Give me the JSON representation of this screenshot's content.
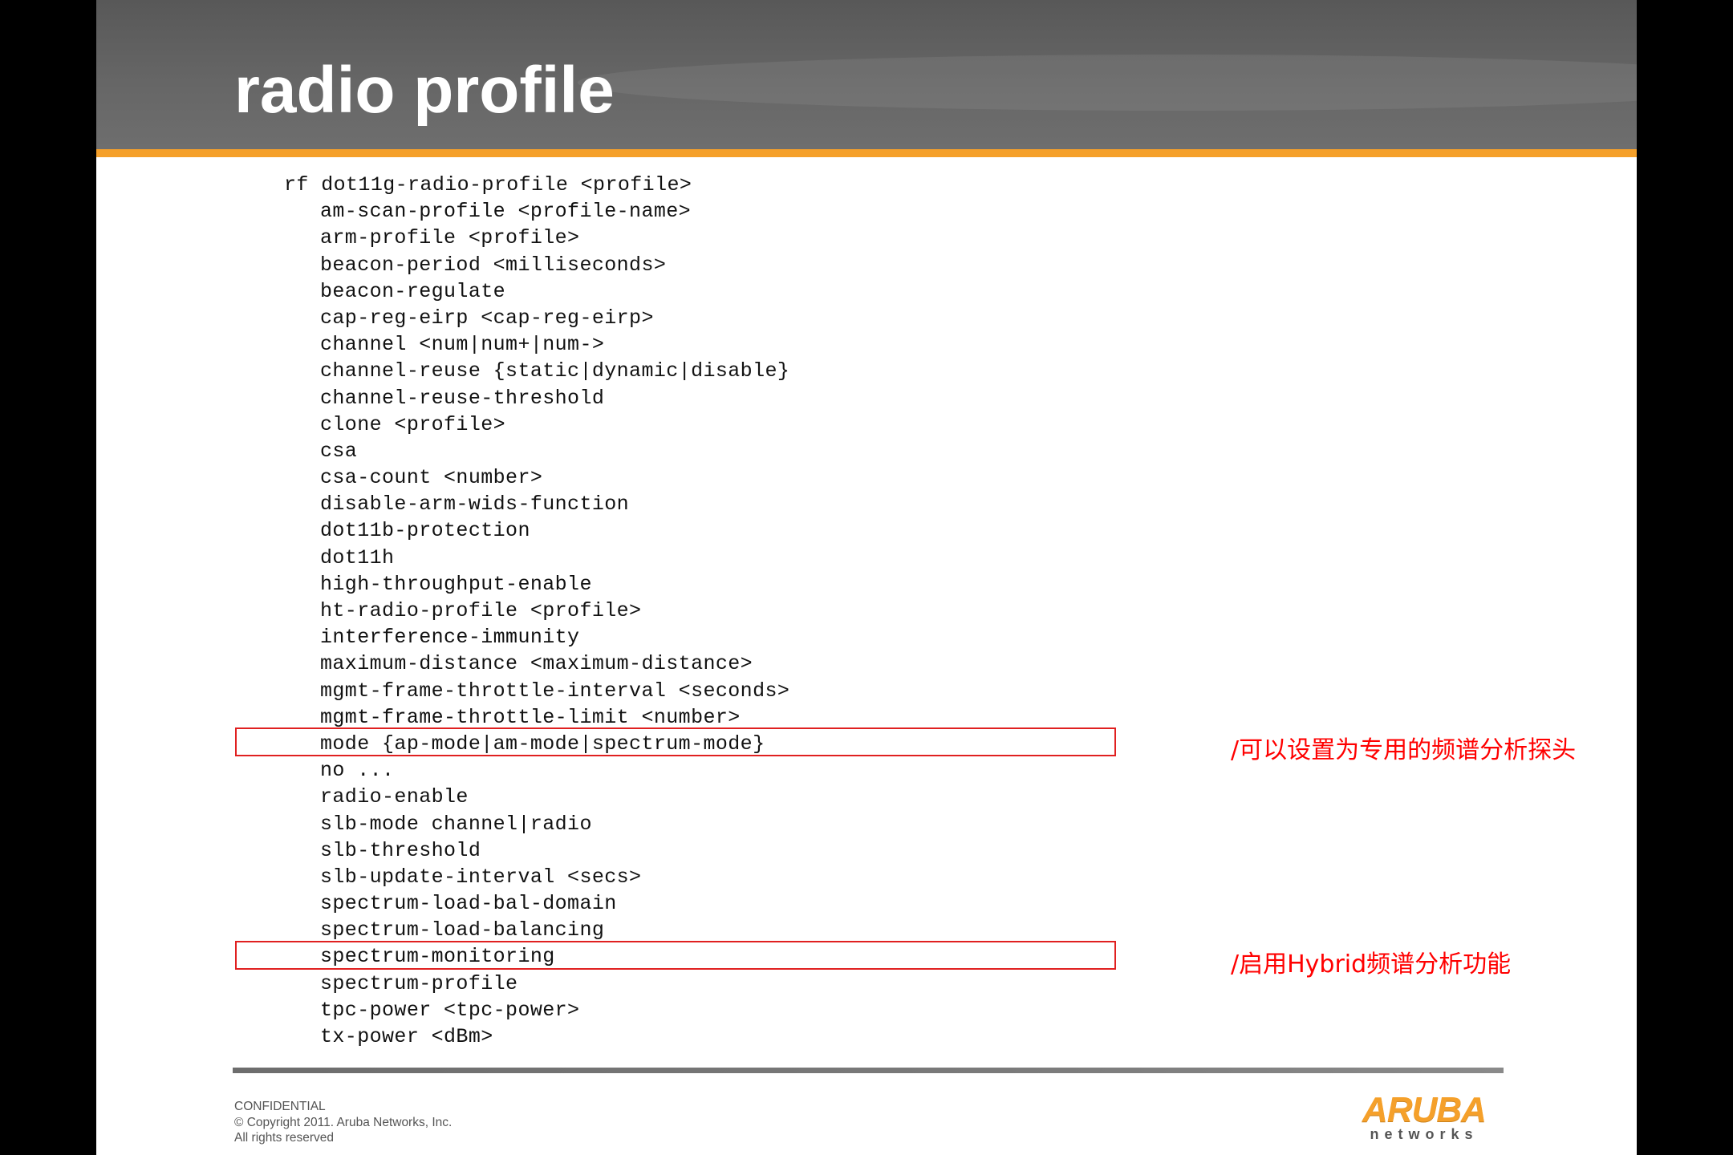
{
  "slide": {
    "title": "radio profile",
    "code_root": "rf dot11g-radio-profile <profile>",
    "code_lines": [
      "am-scan-profile <profile-name>",
      "arm-profile <profile>",
      "beacon-period <milliseconds>",
      "beacon-regulate",
      "cap-reg-eirp <cap-reg-eirp>",
      "channel <num|num+|num->",
      "channel-reuse {static|dynamic|disable}",
      "channel-reuse-threshold",
      "clone <profile>",
      "csa",
      "csa-count <number>",
      "disable-arm-wids-function",
      "dot11b-protection",
      "dot11h",
      "high-throughput-enable",
      "ht-radio-profile <profile>",
      "interference-immunity",
      "maximum-distance <maximum-distance>",
      "mgmt-frame-throttle-interval <seconds>",
      "mgmt-frame-throttle-limit <number>",
      "mode {ap-mode|am-mode|spectrum-mode}",
      "no ...",
      "radio-enable",
      "slb-mode channel|radio",
      "slb-threshold",
      "slb-update-interval <secs>",
      "spectrum-load-bal-domain",
      "spectrum-load-balancing",
      "spectrum-monitoring",
      "spectrum-profile",
      "tpc-power <tpc-power>",
      "tx-power <dBm>"
    ],
    "annotations": {
      "mode_note": "/可以设置为专用的频谱分析探头",
      "spectrum_note": "/启用Hybrid频谱分析功能"
    },
    "footer": {
      "line1": "CONFIDENTIAL",
      "line2": "© Copyright 2011. Aruba Networks, Inc.",
      "line3": "All rights reserved"
    },
    "logo": {
      "word": "ARUBA",
      "sub": "networks"
    },
    "colors": {
      "header": "#666666",
      "accent_stripe": "#f5a02a",
      "highlight_box": "#e02020",
      "annotation_text": "#ff0000"
    }
  }
}
